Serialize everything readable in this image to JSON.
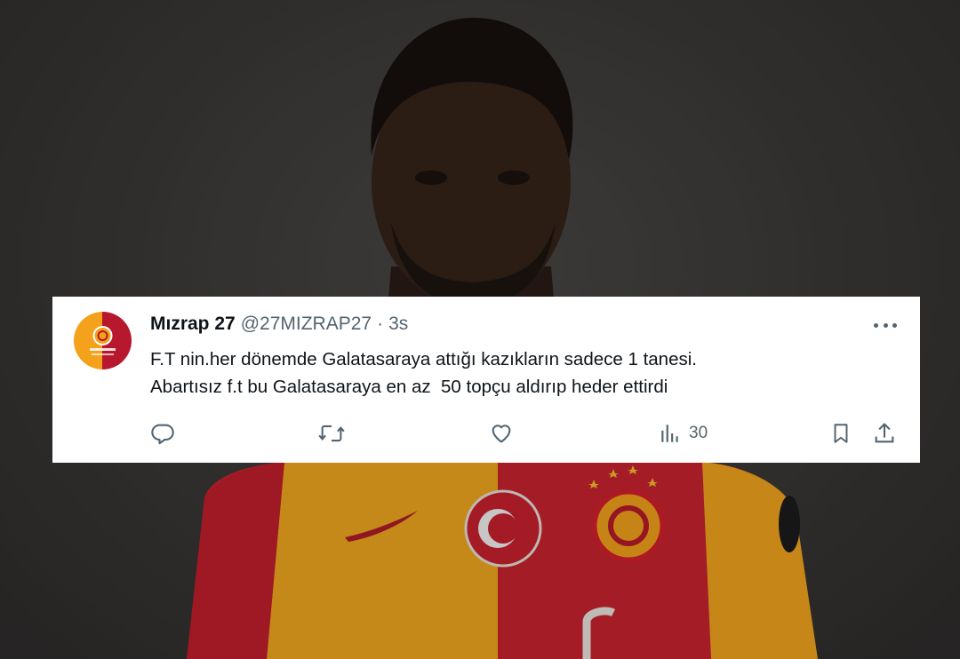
{
  "tweet": {
    "author_name": "Mızrap 27",
    "handle": "@27MIZRAP27",
    "separator": "·",
    "time": "3s",
    "text_lines": [
      "F.T nin.her dönemde Galatasaraya attığı kazıkların sadece 1 tanesi.",
      "Abartısız f.t bu Galatasaraya en az  50 topçu aldırıp heder ettirdi"
    ],
    "views_count": "30"
  },
  "colors": {
    "text": "#0f1419",
    "secondary": "#536471",
    "card_bg": "#ffffff",
    "gs_yellow": "#f4a11c",
    "gs_red": "#b7182d"
  },
  "icons": {
    "reply": "reply-icon",
    "retweet": "retweet-icon",
    "like": "heart-icon",
    "views": "views-icon",
    "bookmark": "bookmark-icon",
    "share": "share-icon",
    "more": "more-icon"
  }
}
